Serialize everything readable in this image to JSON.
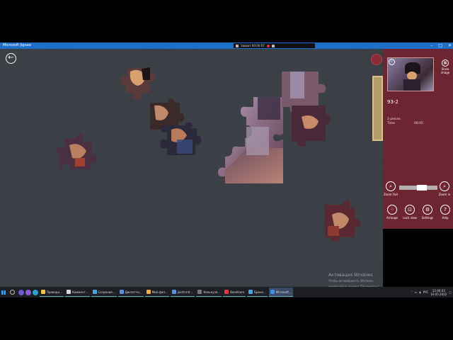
{
  "window": {
    "title": "Microsoft Jigsaw"
  },
  "recorder": {
    "label": "Захват 00:00:07"
  },
  "panel": {
    "show_image_label": "Show image",
    "puzzle_id": "93-2",
    "pieces_label": "2 pieces",
    "time_label": "Time",
    "time_value": "00:05",
    "zoom_out_label": "Zoom Out",
    "zoom_in_label": "Zoom in",
    "zoom_level": 0.62,
    "arrange_label": "Arrange",
    "lock_view_label": "Lock view",
    "settings_label": "Settings",
    "help_label": "Help"
  },
  "watermark": {
    "title": "Активация Windows",
    "subtitle": "Чтобы активировать Windows, перейдите в раздел \"Параметры\"."
  },
  "taskbar": {
    "apps": [
      {
        "label": "Проводн...",
        "color": "#f2c14e"
      },
      {
        "label": "Коммент...",
        "color": "#d9d9d9"
      },
      {
        "label": "Создание...",
        "color": "#4aa3df"
      },
      {
        "label": "Диспетче...",
        "color": "#5b8fd9"
      },
      {
        "label": "Мой фил...",
        "color": "#f0b040"
      },
      {
        "label": "jointl.md ...",
        "color": "#5b8fd9"
      },
      {
        "label": "Калькуля...",
        "color": "#7a7a7a"
      },
      {
        "label": "Bandicam",
        "color": "#e33b3b"
      },
      {
        "label": "Броне...",
        "color": "#4aa3df"
      },
      {
        "label": "Microsoft...",
        "color": "#3b8fe8"
      }
    ],
    "language": "РУС",
    "time": "12:46:03",
    "date": "16.05.2022"
  },
  "colors": {
    "panel": "#6d2631",
    "board": "#3b3f46",
    "titlebar": "#1e6fc9"
  }
}
